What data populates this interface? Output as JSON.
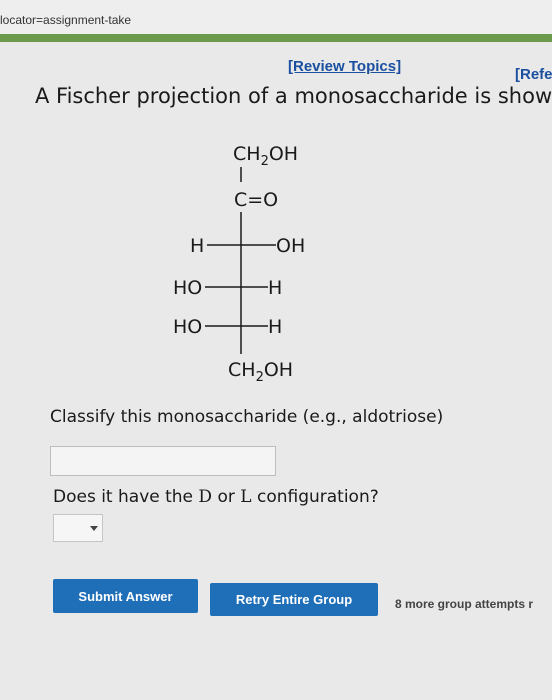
{
  "browser": {
    "url_text": "locator=assignment-take"
  },
  "header": {
    "review_link": "[Review Topics]",
    "ref_link": "[Refe"
  },
  "question": {
    "text": "A Fischer projection of a monosaccharide is showr",
    "structure": {
      "top": "CH2OH",
      "carbonyl": "C=O",
      "row1_left": "H",
      "row1_right": "OH",
      "row2_left": "HO",
      "row2_right": "H",
      "row3_left": "HO",
      "row3_right": "H",
      "bottom": "CH2OH"
    }
  },
  "classify": {
    "label": "Classify this monosaccharide (e.g., aldotriose)",
    "value": ""
  },
  "configuration": {
    "label_prefix": "Does it have the ",
    "d": "D",
    "or": " or ",
    "l": "L",
    "label_suffix": " configuration?",
    "selected": ""
  },
  "actions": {
    "submit": "Submit Answer",
    "retry": "Retry Entire Group",
    "attempts": "8 more group attempts r"
  }
}
